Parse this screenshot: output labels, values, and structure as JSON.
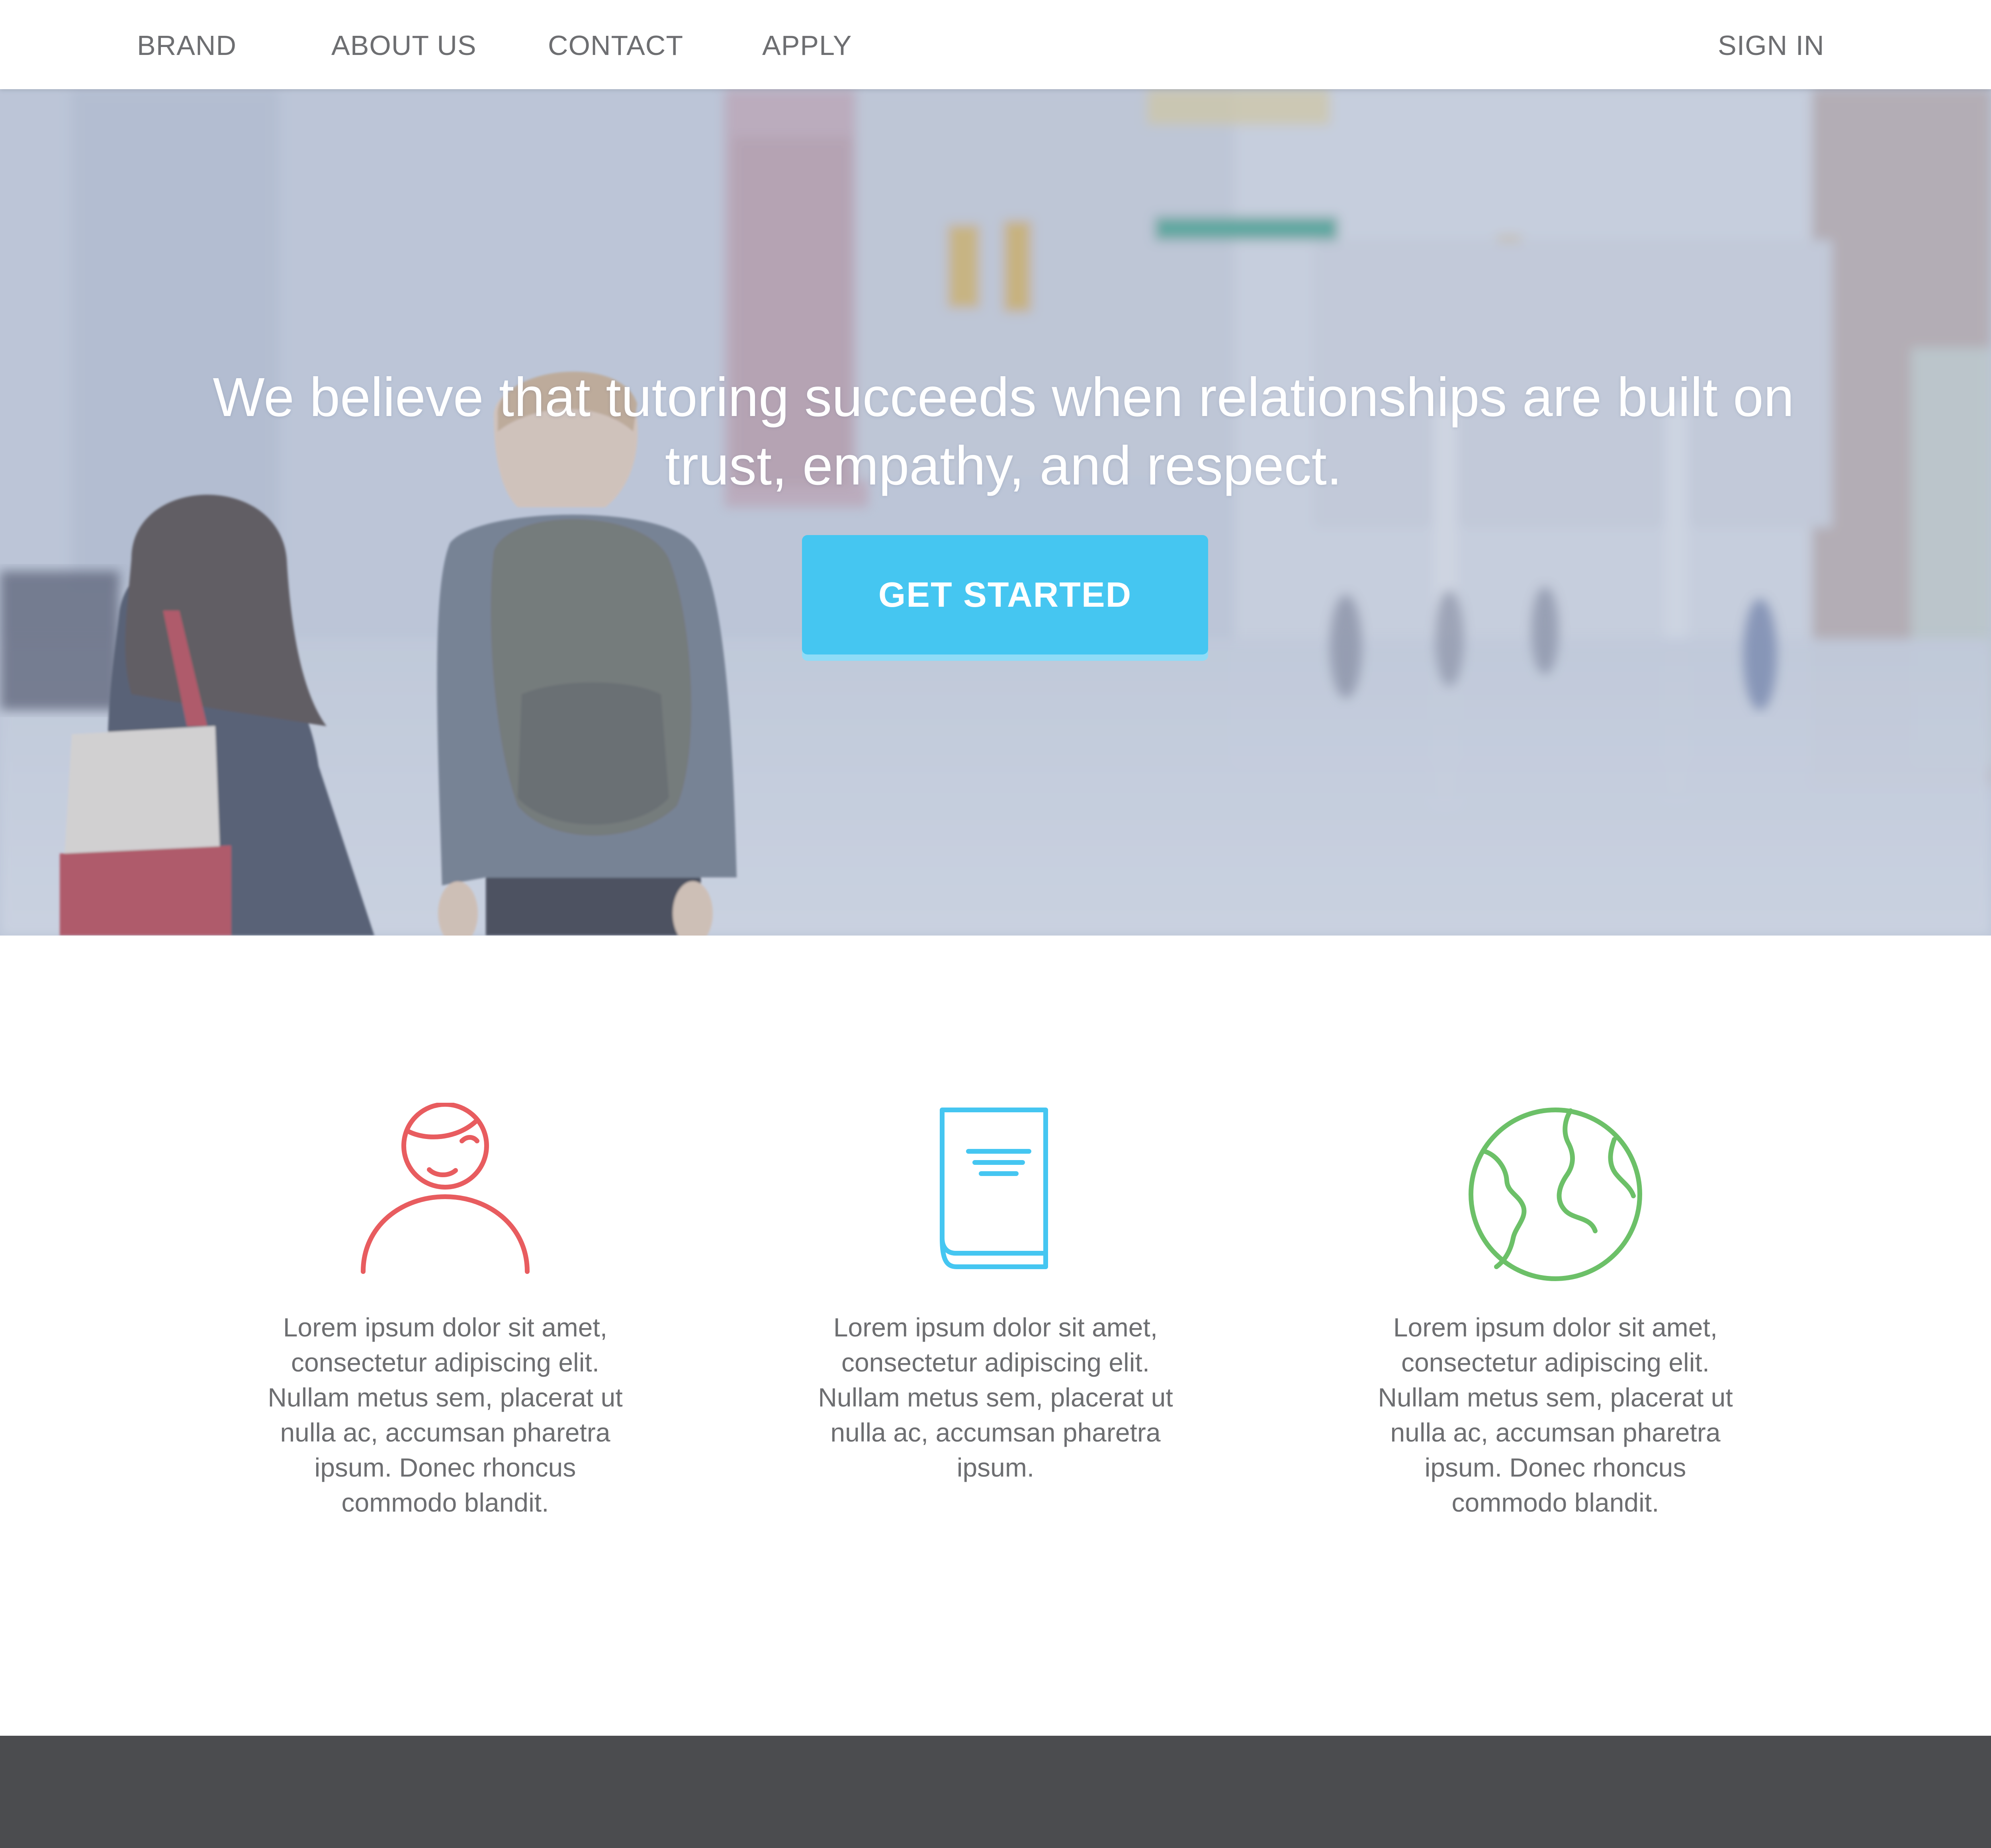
{
  "nav": {
    "brand": "BRAND",
    "about": "ABOUT US",
    "contact": "CONTACT",
    "apply": "APPLY",
    "sign_in": "SIGN IN"
  },
  "hero": {
    "headline": "We believe that tutoring succeeds when relationships are built on trust, empathy, and respect.",
    "cta_label": "GET STARTED",
    "cta_color": "#45c6f1"
  },
  "features": [
    {
      "icon": "person-icon",
      "icon_color": "#e85c5f",
      "text": "Lorem ipsum dolor sit amet, consectetur adipiscing elit. Nullam metus sem, placerat ut nulla ac, accumsan pharetra ipsum. Donec rhoncus commodo blandit."
    },
    {
      "icon": "book-icon",
      "icon_color": "#45c6f1",
      "text": "Lorem ipsum dolor sit amet, consectetur adipiscing elit. Nullam metus sem, placerat ut nulla ac, accumsan pharetra ipsum."
    },
    {
      "icon": "globe-icon",
      "icon_color": "#6cc068",
      "text": "Lorem ipsum dolor sit amet, consectetur adipiscing elit. Nullam metus sem, placerat ut nulla ac, accumsan pharetra ipsum. Donec rhoncus commodo blandit."
    }
  ],
  "footer": {
    "background": "#4b4c4f"
  }
}
